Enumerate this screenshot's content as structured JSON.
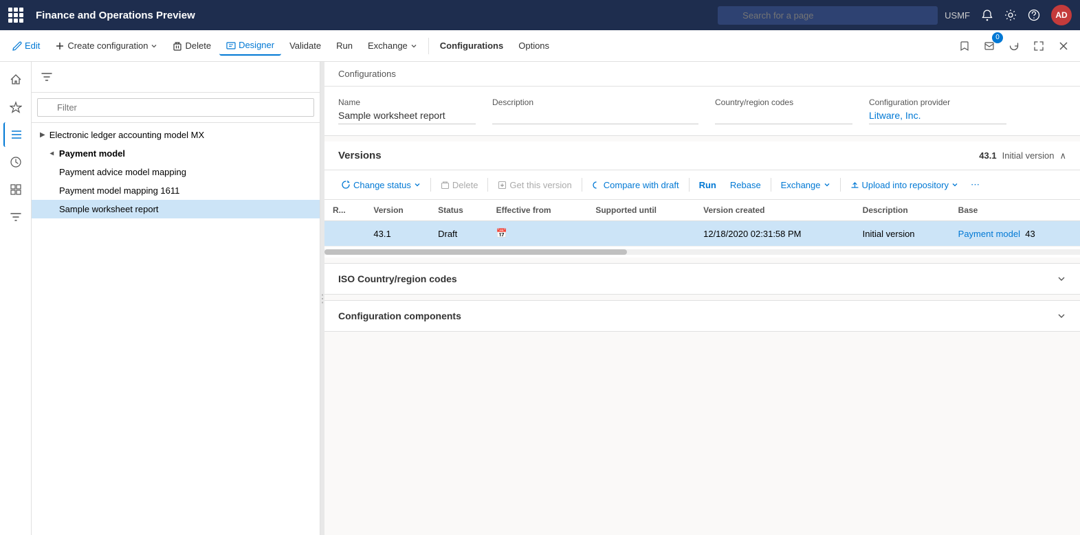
{
  "app": {
    "title": "Finance and Operations Preview",
    "search_placeholder": "Search for a page",
    "user_code": "USMF",
    "user_initials": "AD"
  },
  "toolbar": {
    "edit_label": "Edit",
    "create_config_label": "Create configuration",
    "delete_label": "Delete",
    "designer_label": "Designer",
    "validate_label": "Validate",
    "run_label": "Run",
    "exchange_label": "Exchange",
    "configurations_label": "Configurations",
    "options_label": "Options"
  },
  "sidebar": {
    "items": [
      {
        "name": "home",
        "icon": "⌂"
      },
      {
        "name": "favorites",
        "icon": "★"
      },
      {
        "name": "recent",
        "icon": "⏱"
      },
      {
        "name": "workspaces",
        "icon": "▦"
      },
      {
        "name": "list",
        "icon": "☰"
      }
    ]
  },
  "filter": {
    "placeholder": "Filter"
  },
  "tree": {
    "items": [
      {
        "label": "Electronic ledger accounting model MX",
        "level": 0,
        "expanded": false,
        "icon": "▶"
      },
      {
        "label": "Payment model",
        "level": 0,
        "expanded": true,
        "icon": "◀"
      },
      {
        "label": "Payment advice model mapping",
        "level": 1,
        "expanded": false,
        "icon": ""
      },
      {
        "label": "Payment model mapping 1611",
        "level": 1,
        "expanded": false,
        "icon": ""
      },
      {
        "label": "Sample worksheet report",
        "level": 1,
        "expanded": false,
        "icon": "",
        "selected": true
      }
    ]
  },
  "breadcrumb": "Configurations",
  "configuration": {
    "name_label": "Name",
    "name_value": "Sample worksheet report",
    "description_label": "Description",
    "description_value": "",
    "country_label": "Country/region codes",
    "country_value": "",
    "provider_label": "Configuration provider",
    "provider_value": "Litware, Inc."
  },
  "versions": {
    "title": "Versions",
    "version_number": "43.1",
    "version_status": "Initial version",
    "toolbar": {
      "change_status": "Change status",
      "delete": "Delete",
      "get_this_version": "Get this version",
      "compare_with_draft": "Compare with draft",
      "run": "Run",
      "rebase": "Rebase",
      "exchange": "Exchange",
      "upload_into_repository": "Upload into repository"
    },
    "table": {
      "columns": [
        "R...",
        "Version",
        "Status",
        "Effective from",
        "Supported until",
        "Version created",
        "Description",
        "Base"
      ],
      "rows": [
        {
          "r": "",
          "version": "43.1",
          "status": "Draft",
          "effective_from": "",
          "supported_until": "",
          "version_created": "12/18/2020 02:31:58 PM",
          "description": "Initial version",
          "base": "Payment model",
          "base_num": "43",
          "selected": true
        }
      ]
    }
  },
  "iso_section": {
    "title": "ISO Country/region codes"
  },
  "components_section": {
    "title": "Configuration components"
  }
}
